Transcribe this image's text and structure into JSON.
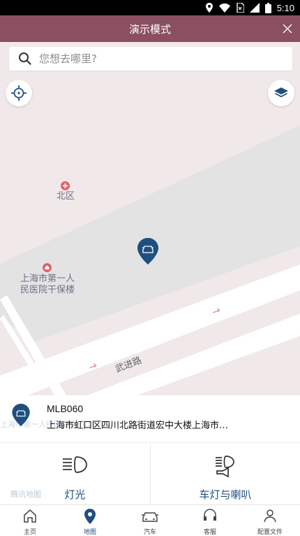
{
  "status_bar": {
    "time": "5:10"
  },
  "header": {
    "title": "演示模式"
  },
  "search": {
    "placeholder": "您想去哪里?"
  },
  "map": {
    "poi_north": "北区",
    "poi_hospital": "上海市第一人\n民医院干保楼",
    "road_name": "武进路",
    "watermark": "腾讯地图",
    "watermark2": "上海市第一人民医院北门(北门)"
  },
  "vehicle": {
    "id": "MLB060",
    "address": "上海市虹口区四川北路街道宏中大楼上海市…"
  },
  "features": [
    {
      "label": "灯光",
      "icon": "headlight-icon"
    },
    {
      "label": "车灯与喇叭",
      "icon": "headlight-horn-icon"
    }
  ],
  "tabs": [
    {
      "label": "主页",
      "icon": "home-icon"
    },
    {
      "label": "地图",
      "icon": "map-pin-icon",
      "active": true
    },
    {
      "label": "汽车",
      "icon": "car-icon"
    },
    {
      "label": "客服",
      "icon": "headset-icon"
    },
    {
      "label": "配置文件",
      "icon": "profile-icon"
    }
  ],
  "colors": {
    "header": "#8b4f62",
    "accent": "#1f4f80",
    "map_bg": "#f1e8e9",
    "block": "#e4e3e3"
  }
}
